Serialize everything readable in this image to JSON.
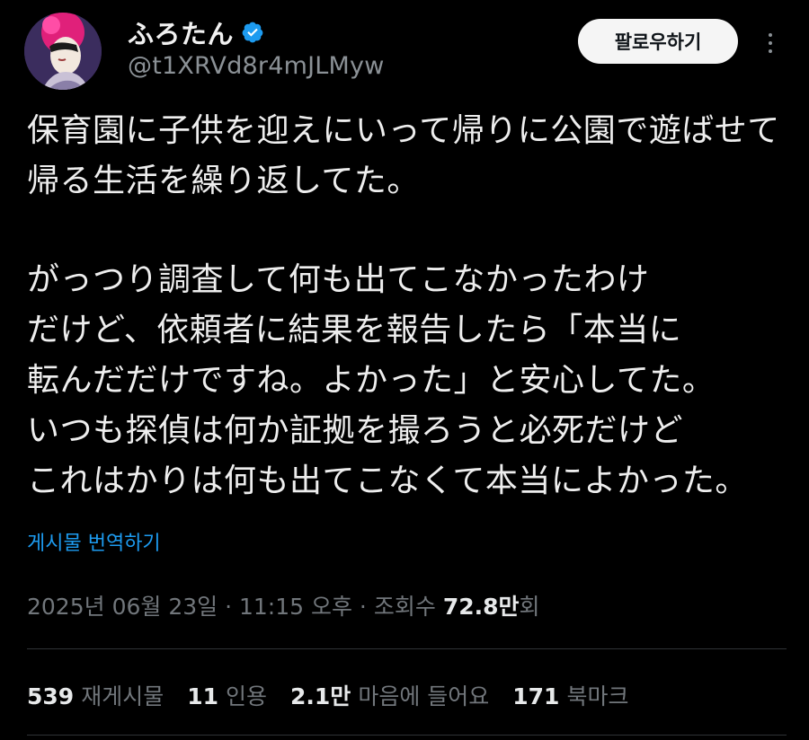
{
  "author": {
    "display_name": "ふろたん",
    "handle": "@t1XRVd8r4mJLMyw",
    "verified": true,
    "avatar_icon": "portrait-avatar"
  },
  "actions": {
    "follow_label": "팔로우하기",
    "more_icon": "more-vertical-icon"
  },
  "tweet": {
    "lines": [
      "保育園に子供を迎えにいって帰りに公園で遊ばせて",
      "帰る生活を繰り返してた。",
      "",
      "がっつり調査して何も出てこなかったわけ",
      "だけど、依頼者に結果を報告したら「本当に",
      "転んだだけですね。よかった」と安心してた。",
      "いつも探偵は何か証拠を撮ろうと必死だけど",
      "これはかりは何も出てこなくて本当によかった。"
    ],
    "translate_label": "게시물 번역하기"
  },
  "meta": {
    "timestamp": "2025년 06월 23일 · 11:15 오후 · 조회수",
    "views_number": "72.8만",
    "views_suffix": "회"
  },
  "stats": [
    {
      "number": "539",
      "label": "재게시물"
    },
    {
      "number": "11",
      "label": "인용"
    },
    {
      "number": "2.1만",
      "label": "마음에 들어요"
    },
    {
      "number": "171",
      "label": "북마크"
    }
  ],
  "colors": {
    "background": "#000000",
    "text": "#e7e9ea",
    "secondary": "#71767b",
    "link": "#1d9bf0",
    "verified": "#1d9bf0",
    "divider": "#2f3336"
  }
}
